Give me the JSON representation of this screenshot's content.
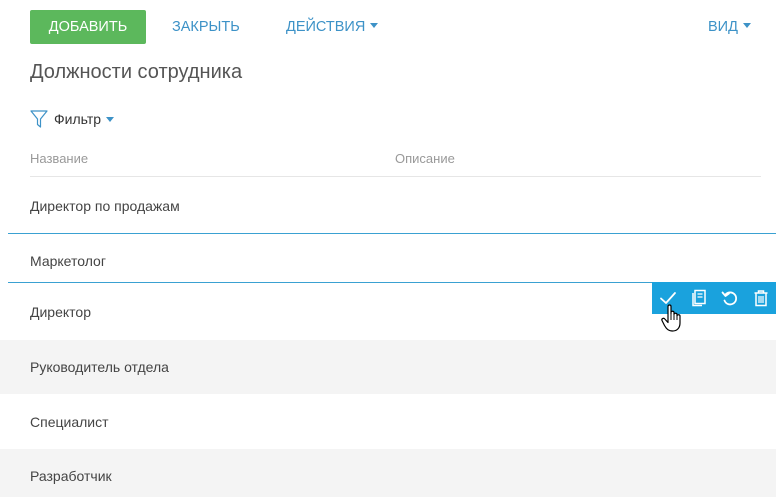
{
  "toolbar": {
    "add_label": "ДОБАВИТЬ",
    "close_label": "ЗАКРЫТЬ",
    "actions_label": "ДЕЙСТВИЯ",
    "view_label": "ВИД"
  },
  "page": {
    "title": "Должности сотрудника"
  },
  "filter": {
    "label": "Фильтр"
  },
  "table": {
    "columns": [
      "Название",
      "Описание"
    ],
    "rows": [
      "Директор по продажам",
      "Маркетолог",
      "Директор",
      "Руководитель отдела",
      "Специалист",
      "Разработчик"
    ],
    "selected_row": "Директор"
  },
  "row_actions": {
    "icons": [
      "check-icon",
      "copy-icon",
      "undo-icon",
      "trash-icon"
    ]
  },
  "colors": {
    "add_button": "#5cb85c",
    "link": "#3d92c7",
    "actions_panel": "#1aa2dd",
    "selection_line": "#3aa1d2",
    "alt_row": "#f4f4f4"
  }
}
